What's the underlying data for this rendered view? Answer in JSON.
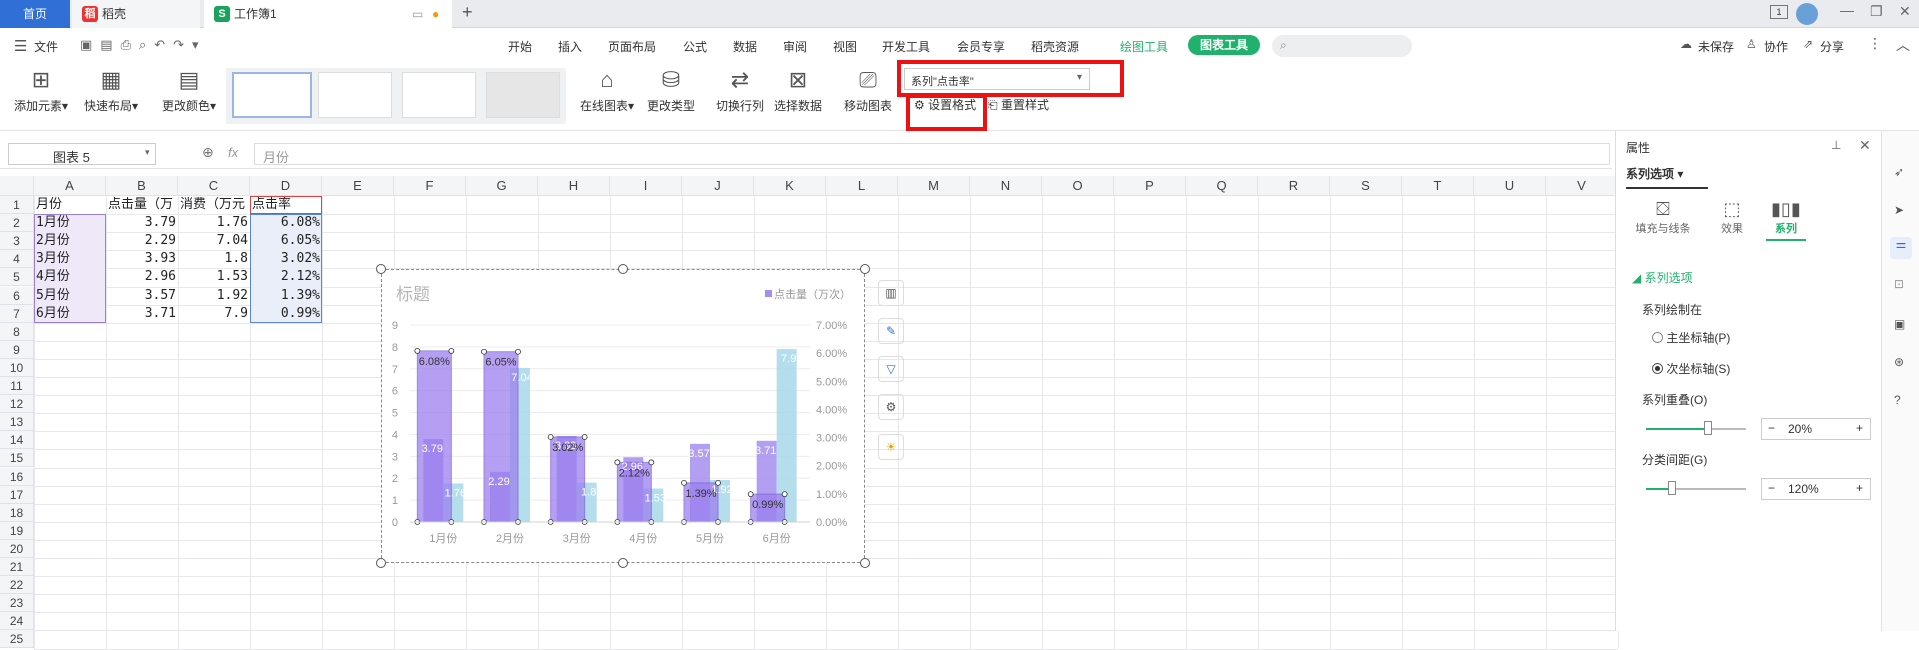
{
  "tabs": {
    "home": "首页",
    "docer": "稻壳",
    "workbook": "工作簿1"
  },
  "menu": {
    "file": "文件",
    "items": [
      "开始",
      "插入",
      "页面布局",
      "公式",
      "数据",
      "审阅",
      "视图",
      "开发工具",
      "会员专享",
      "稻壳资源"
    ],
    "drawing_tools": "绘图工具",
    "chart_tools": "图表工具",
    "unsaved": "未保存",
    "collab": "协作",
    "share": "分享"
  },
  "ribbon": {
    "add_element": "添加元素",
    "quick_layout": "快速布局",
    "change_color": "更改颜色",
    "online_chart": "在线图表",
    "change_type": "更改类型",
    "switch_rowcol": "切换行列",
    "select_data": "选择数据",
    "move_chart": "移动图表",
    "series_select": "系列\"点击率\"",
    "format_selection": "设置格式",
    "reset_style": "重置样式"
  },
  "formula": {
    "name_box": "图表 5",
    "fx": "fx",
    "content": "月份"
  },
  "grid": {
    "columns": [
      "A",
      "B",
      "C",
      "D",
      "E",
      "F",
      "G",
      "H",
      "I",
      "J",
      "K",
      "L",
      "M",
      "N",
      "O",
      "P",
      "Q",
      "R",
      "S",
      "T",
      "U",
      "V"
    ],
    "rows": [
      "1",
      "2",
      "3",
      "4",
      "5",
      "6",
      "7",
      "8",
      "9",
      "10",
      "11",
      "12",
      "13",
      "14",
      "15",
      "16",
      "17",
      "18",
      "19",
      "20",
      "21",
      "22",
      "23",
      "24",
      "25"
    ],
    "header": [
      "月份",
      "点击量（万",
      "消费（万元",
      "点击率"
    ],
    "data": [
      [
        "1月份",
        "3.79",
        "1.76",
        "6.08%"
      ],
      [
        "2月份",
        "2.29",
        "7.04",
        "6.05%"
      ],
      [
        "3月份",
        "3.93",
        "1.8",
        "3.02%"
      ],
      [
        "4月份",
        "2.96",
        "1.53",
        "2.12%"
      ],
      [
        "5月份",
        "3.57",
        "1.92",
        "1.39%"
      ],
      [
        "6月份",
        "3.71",
        "7.9",
        "0.99%"
      ]
    ]
  },
  "chart_data": {
    "type": "bar",
    "title": "标题",
    "legend": "点击量（万次）",
    "categories": [
      "1月份",
      "2月份",
      "3月份",
      "4月份",
      "5月份",
      "6月份"
    ],
    "series": [
      {
        "name": "点击量（万次）",
        "values": [
          3.79,
          2.29,
          3.93,
          2.96,
          3.57,
          3.71
        ],
        "color": "#a48ef0"
      },
      {
        "values": [
          1.76,
          7.04,
          1.8,
          1.53,
          1.92,
          7.9
        ],
        "color": "#a8d8ea"
      },
      {
        "values": [
          6.08,
          6.05,
          3.02,
          2.12,
          1.39,
          0.99
        ],
        "color": "#9b80ee"
      }
    ],
    "primary_labels": [
      [
        "3.79",
        "1.76"
      ],
      [
        "2.29",
        "7.04"
      ],
      [
        "3.93",
        "1.8"
      ],
      [
        "2.96",
        "1.53"
      ],
      [
        "3.57",
        "1.92"
      ],
      [
        "3.71",
        "7.9"
      ]
    ],
    "secondary_labels": [
      "6.08%",
      "6.05%",
      "3.02%",
      "2.12%",
      "1.39%",
      "0.99%"
    ],
    "yaxis_left": {
      "min": 0,
      "max": 9,
      "ticks": [
        "0",
        "1",
        "2",
        "3",
        "4",
        "5",
        "6",
        "7",
        "8",
        "9"
      ]
    },
    "yaxis_right": {
      "min": 0,
      "max": 7,
      "ticks": [
        "0.00%",
        "1.00%",
        "2.00%",
        "3.00%",
        "4.00%",
        "5.00%",
        "6.00%",
        "7.00%"
      ]
    }
  },
  "panel": {
    "title": "属性",
    "series_options_tab": "系列选项",
    "sub_tabs": [
      "填充与线条",
      "效果",
      "系列"
    ],
    "section": "系列选项",
    "plot_on": "系列绘制在",
    "primary_axis": "主坐标轴(P)",
    "secondary_axis": "次坐标轴(S)",
    "overlap_label": "系列重叠(O)",
    "overlap_value": "20%",
    "gap_label": "分类间距(G)",
    "gap_value": "120%"
  },
  "colors": {
    "accent": "#2f6fd6",
    "green": "#20b26c",
    "highlight": "#ee1111"
  }
}
